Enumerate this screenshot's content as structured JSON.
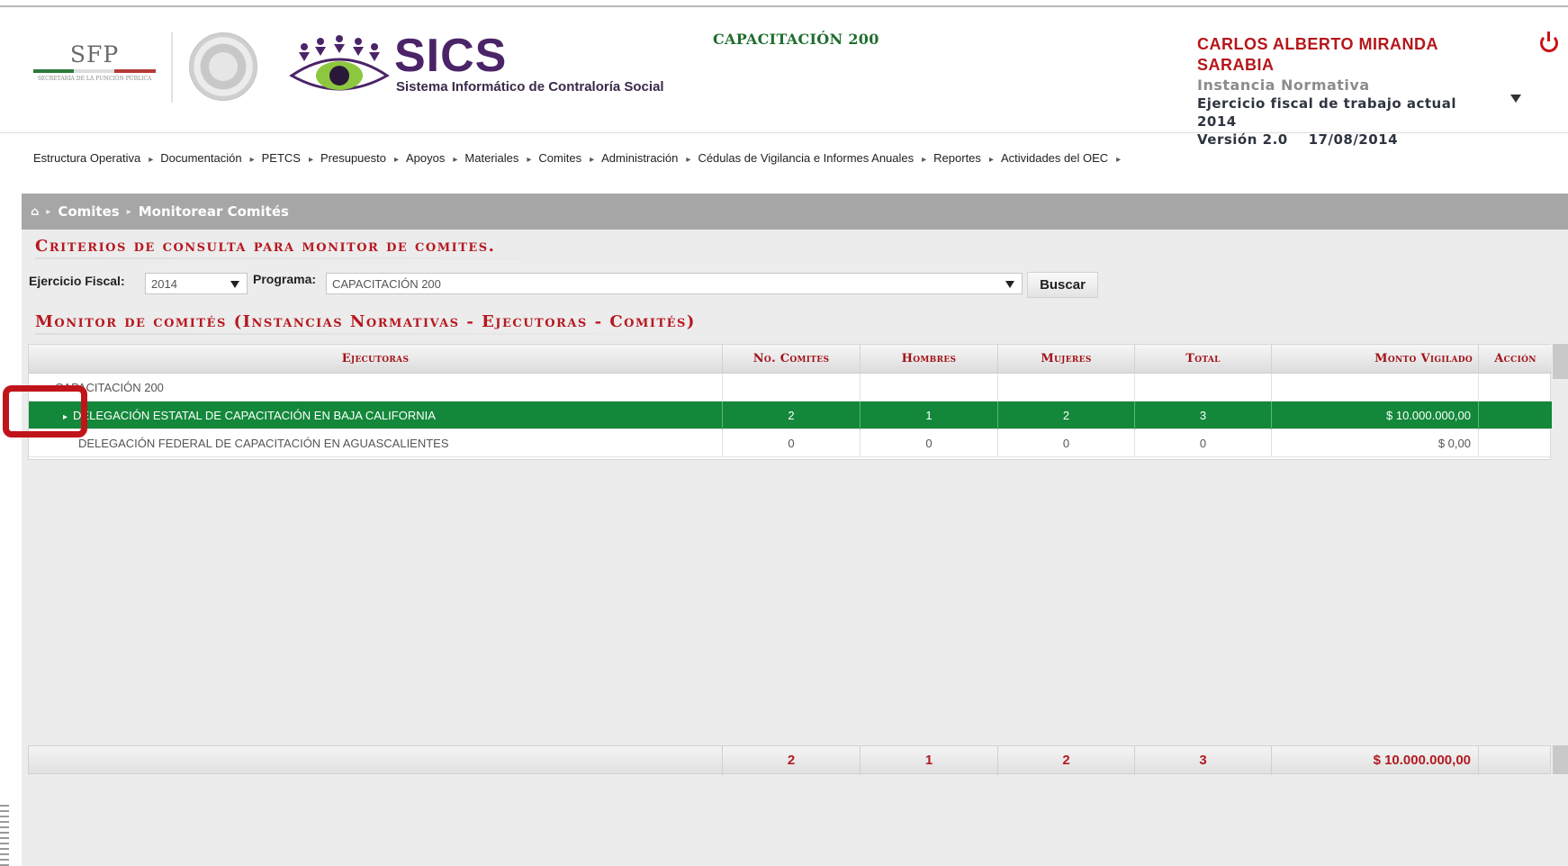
{
  "header": {
    "sfp_title": "SFP",
    "sfp_subtitle": "SECRETARÍA DE LA FUNCIÓN PÚBLICA",
    "app_name": "SICS",
    "app_subtitle": "Sistema Informático de Contraloría Social",
    "program_title": "CAPACITACIÓN 200",
    "user_name": "CARLOS ALBERTO MIRANDA SARABIA",
    "user_role": "Instancia Normativa",
    "fiscal_line": "Ejercicio fiscal de trabajo actual 2014",
    "version_line": "Versión 2.0    17/08/2014"
  },
  "menu": {
    "items": [
      {
        "label": "Estructura Operativa"
      },
      {
        "label": "Documentación"
      },
      {
        "label": "PETCS"
      },
      {
        "label": "Presupuesto"
      },
      {
        "label": "Apoyos"
      },
      {
        "label": "Materiales"
      },
      {
        "label": "Comites"
      },
      {
        "label": "Administración"
      },
      {
        "label": "Cédulas de Vigilancia e Informes Anuales"
      },
      {
        "label": "Reportes"
      },
      {
        "label": "Actividades del OEC"
      }
    ]
  },
  "breadcrumb": {
    "home_icon": "home-icon",
    "items": [
      "Comites",
      "Monitorear Comités"
    ]
  },
  "criteria": {
    "title": "Criterios de consulta para monitor de comites.",
    "fiscal_label": "Ejercicio Fiscal:",
    "fiscal_value": "2014",
    "program_label": "Programa:",
    "program_value": "CAPACITACIÓN 200",
    "search_button": "Buscar"
  },
  "monitor": {
    "title": "Monitor de comités (Instancias Normativas - Ejecutoras - Comités)",
    "columns": [
      "Ejecutoras",
      "No. Comites",
      "Hombres",
      "Mujeres",
      "Total",
      "Monto Vigilado",
      "Acción"
    ],
    "rows": [
      {
        "ejecutora": "CAPACITACIÓN 200",
        "no_comites": "",
        "hombres": "",
        "mujeres": "",
        "total": "",
        "monto": "",
        "accion": ""
      },
      {
        "ejecutora": "DELEGACIÓN ESTATAL DE CAPACITACIÓN EN BAJA CALIFORNIA",
        "no_comites": "2",
        "hombres": "1",
        "mujeres": "2",
        "total": "3",
        "monto": "$ 10.000.000,00",
        "accion": ""
      },
      {
        "ejecutora": "DELEGACIÓN FEDERAL DE CAPACITACIÓN EN AGUASCALIENTES",
        "no_comites": "0",
        "hombres": "0",
        "mujeres": "0",
        "total": "0",
        "monto": "$ 0,00",
        "accion": ""
      }
    ],
    "totals": {
      "no_comites": "2",
      "hombres": "1",
      "mujeres": "2",
      "total": "3",
      "monto": "$ 10.000.000,00"
    }
  },
  "colors": {
    "selected_row": "#13883a",
    "accent_red": "#b71820",
    "brand_purple": "#4b2468",
    "program_green": "#1f6e2e"
  }
}
